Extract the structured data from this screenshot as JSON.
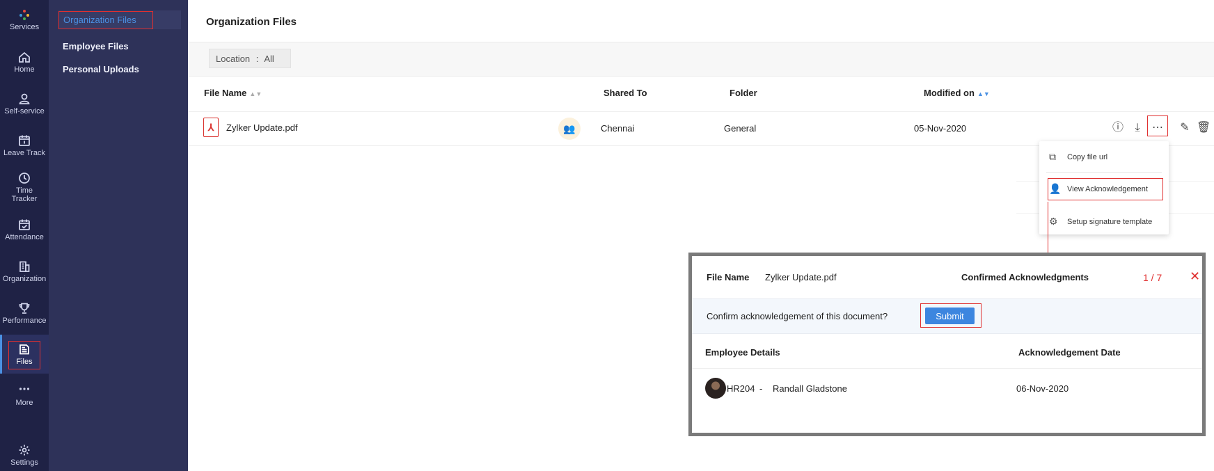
{
  "rail": {
    "items": [
      {
        "label": "Services",
        "icon": "services-icon"
      },
      {
        "label": "Home",
        "icon": "home-icon"
      },
      {
        "label": "Self-service",
        "icon": "user-icon"
      },
      {
        "label": "Leave Track",
        "icon": "calendar-icon"
      },
      {
        "label": "Time Tracker",
        "icon": "clock-icon"
      },
      {
        "label": "Attendance",
        "icon": "calendar-check-icon"
      },
      {
        "label": "Organization",
        "icon": "building-icon"
      },
      {
        "label": "Performance",
        "icon": "trophy-icon"
      },
      {
        "label": "Files",
        "icon": "files-icon"
      },
      {
        "label": "More",
        "icon": "more-dots-icon"
      },
      {
        "label": "Settings",
        "icon": "gear-icon"
      }
    ],
    "active": "Files"
  },
  "subnav": {
    "items": [
      {
        "label": "Organization Files"
      },
      {
        "label": "Employee Files"
      },
      {
        "label": "Personal Uploads"
      }
    ]
  },
  "main": {
    "title": "Organization Files",
    "filter": {
      "label": "Location",
      "separator": ":",
      "value": "All"
    },
    "table": {
      "headers": {
        "file_name": "File Name",
        "shared_to": "Shared To",
        "folder": "Folder",
        "modified_on": "Modified on"
      },
      "rows": [
        {
          "file_name": "Zylker Update.pdf",
          "shared_to": "Chennai",
          "folder": "General",
          "modified_on": "05-Nov-2020"
        }
      ]
    },
    "menu": {
      "items": [
        {
          "label": "Copy file url",
          "icon": "copy-icon"
        },
        {
          "label": "View Acknowledgement",
          "icon": "user-check-icon"
        },
        {
          "label": "Setup signature template",
          "icon": "gear-icon"
        }
      ]
    }
  },
  "ack_panel": {
    "file_name_label": "File Name",
    "file_name": "Zylker Update.pdf",
    "confirmed_label": "Confirmed Acknowledgments",
    "confirmed_count": "1 / 7",
    "confirm_question": "Confirm acknowledgement of this document?",
    "submit_label": "Submit",
    "headers": {
      "employee": "Employee Details",
      "date": "Acknowledgement Date"
    },
    "rows": [
      {
        "employee_id": "HR204",
        "separator": "-",
        "name": "Randall Gladstone",
        "date": "06-Nov-2020"
      }
    ]
  },
  "colors": {
    "rail_bg": "#1f2245",
    "subnav_bg": "#2e3259",
    "accent": "#4a90e2",
    "highlight": "#e03030",
    "pdf": "#d9302c"
  }
}
